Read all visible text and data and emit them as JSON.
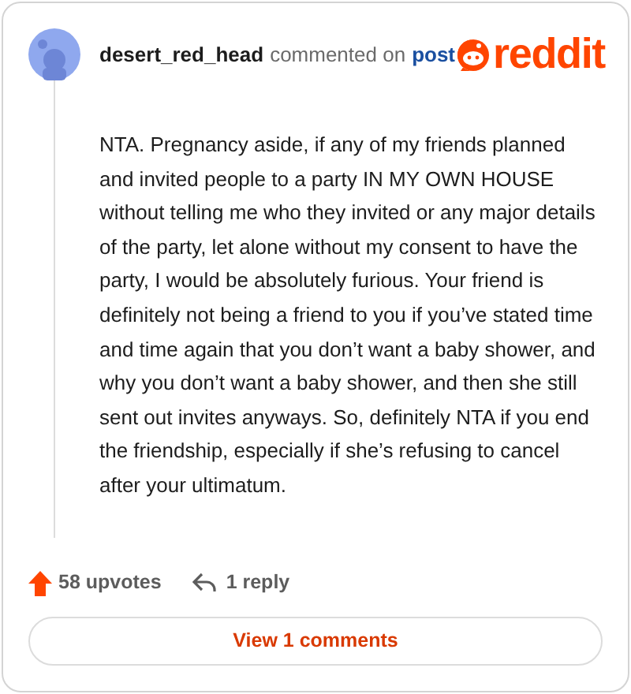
{
  "comment": {
    "author": "desert_red_head",
    "action": "commented on",
    "link": "post",
    "brand": "reddit",
    "body": "NTA. Pregnancy aside, if any of my friends planned and invited people to a party IN MY OWN HOUSE without telling me who they invited or any major details of the party, let alone without my consent to have the party, I would be absolutely furious. Your friend is definitely not being a friend to you if you’ve stated time and time again that you don’t want a baby shower, and why you don’t want a baby shower, and then she still sent out invites anyways. So, definitely NTA if you end the friendship, especially if she’s refusing to cancel after your ultimatum.",
    "upvotes": "58 upvotes",
    "replies": "1 reply"
  },
  "button": "View 1 comments"
}
